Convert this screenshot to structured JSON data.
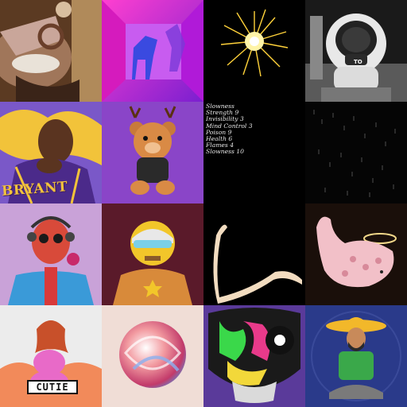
{
  "gallery": {
    "tiles": [
      {
        "icon": "mechanical-bird-image"
      },
      {
        "icon": "neon-horse-image"
      },
      {
        "icon": "golden-burst-image"
      },
      {
        "icon": "astronaut-image"
      },
      {
        "icon": "basketball-player-image",
        "jersey_text": "BRYANT"
      },
      {
        "icon": "teddy-bear-image"
      },
      {
        "icon": "attribute-list-tile",
        "attributes": [
          "Slowness",
          "Strength 9",
          "Invisibility 3",
          "Mind Control 3",
          "Poison 9",
          "Health 6",
          "Flames 4",
          "Slowness 10"
        ]
      },
      {
        "icon": "dark-pattern-image"
      },
      {
        "icon": "red-skull-image"
      },
      {
        "icon": "robot-image"
      },
      {
        "icon": "brush-stroke-image"
      },
      {
        "icon": "angel-whale-image"
      },
      {
        "icon": "cutie-character-image",
        "label": "CUTIE"
      },
      {
        "icon": "abstract-swirl-image"
      },
      {
        "icon": "graffiti-skull-image"
      },
      {
        "icon": "sombrero-man-image"
      }
    ],
    "astronaut_helmet_text": "TO"
  }
}
